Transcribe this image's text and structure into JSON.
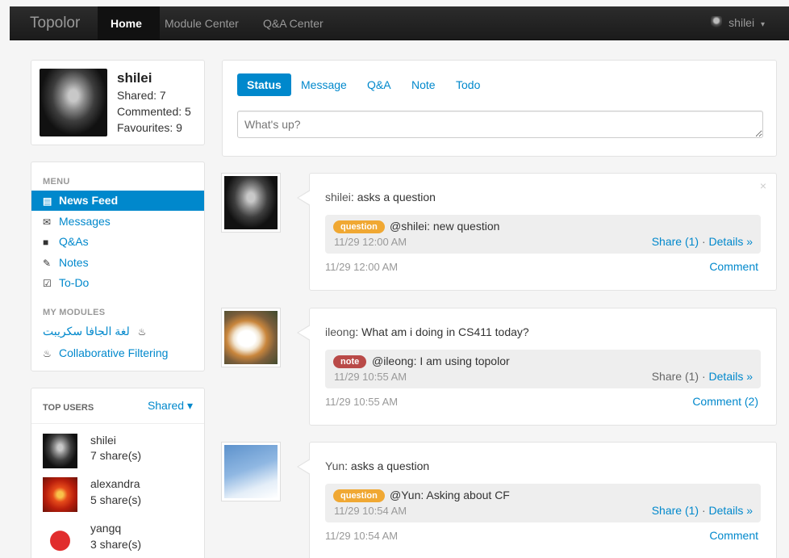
{
  "nav": {
    "brand": "Topolor",
    "items": [
      "Home",
      "Module Center",
      "Q&A Center"
    ],
    "user": "shilei",
    "caret": "▾"
  },
  "profile": {
    "name": "shilei",
    "shared": "Shared: 7",
    "commented": "Commented: 5",
    "favourites": "Favourites: 9"
  },
  "menu": {
    "header": "MENU",
    "items": [
      {
        "label": "News Feed",
        "icon": "▤"
      },
      {
        "label": "Messages",
        "icon": "✉"
      },
      {
        "label": "Q&As",
        "icon": "■"
      },
      {
        "label": "Notes",
        "icon": "✎"
      },
      {
        "label": "To-Do",
        "icon": "☑"
      }
    ],
    "modules_header": "MY MODULES",
    "modules": [
      {
        "label": "لغة الجافا سكريبت",
        "icon": "♨"
      },
      {
        "label": "Collaborative Filtering",
        "icon": "♨"
      }
    ]
  },
  "top_users": {
    "header": "TOP USERS",
    "sort": "Shared ▾",
    "users": [
      {
        "name": "shilei",
        "count": "7 share(s)"
      },
      {
        "name": "alexandra",
        "count": "5 share(s)"
      },
      {
        "name": "yangq",
        "count": "3 share(s)"
      }
    ]
  },
  "composer": {
    "tabs": [
      "Status",
      "Message",
      "Q&A",
      "Note",
      "Todo"
    ],
    "placeholder": "What's up?"
  },
  "feed": [
    {
      "user": "shilei",
      "action": "asks a question",
      "badge": "question",
      "quote": "@shilei: new question",
      "quote_time": "11/29 12:00 AM",
      "share": "Share (1)",
      "details": "Details »",
      "time": "11/29 12:00 AM",
      "comment": "Comment",
      "close": "×"
    },
    {
      "user": "ileong",
      "action": "What am i doing in CS411 today?",
      "badge": "note",
      "quote": "@ileong: I am using topolor",
      "quote_time": "11/29 10:55 AM",
      "share": "Share (1)",
      "details": "Details »",
      "time": "11/29 10:55 AM",
      "comment": "Comment (2)"
    },
    {
      "user": "Yun",
      "action": "asks a question",
      "badge": "question",
      "quote": "@Yun: Asking about CF",
      "quote_time": "11/29 10:54 AM",
      "share": "Share (1)",
      "details": "Details »",
      "time": "11/29 10:54 AM",
      "comment": "Comment"
    }
  ],
  "colors": {
    "accent": "#0088cc",
    "navbar": "#1b1b1b",
    "badge_question": "#f0a833",
    "badge_note": "#b94a48"
  }
}
